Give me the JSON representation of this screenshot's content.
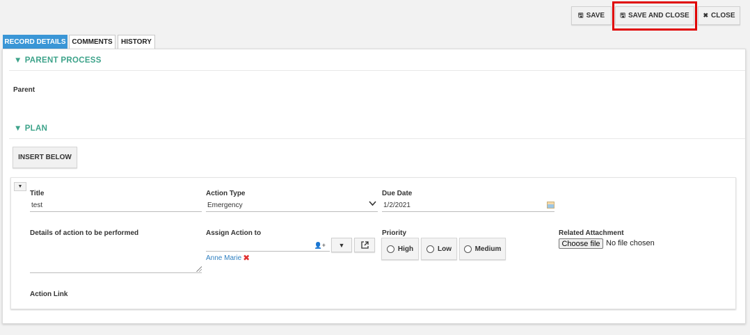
{
  "toolbar": {
    "save_label": "SAVE",
    "save_close_label": "SAVE AND CLOSE",
    "close_label": "CLOSE",
    "save_icon": "save-icon",
    "close_icon": "x-icon"
  },
  "tabs": [
    {
      "label": "RECORD DETAILS",
      "active": true
    },
    {
      "label": "COMMENTS",
      "active": false
    },
    {
      "label": "HISTORY",
      "active": false
    }
  ],
  "sections": {
    "parent_process": {
      "title": "PARENT PROCESS",
      "parent_label": "Parent"
    },
    "plan": {
      "title": "PLAN",
      "insert_below_label": "INSERT BELOW"
    }
  },
  "plan_item": {
    "title": {
      "label": "Title",
      "value": "test"
    },
    "action_type": {
      "label": "Action Type",
      "value": "Emergency"
    },
    "due_date": {
      "label": "Due Date",
      "value": "1/2/2021"
    },
    "details": {
      "label": "Details of action to be performed",
      "value": ""
    },
    "assign": {
      "label": "Assign Action to",
      "value": "",
      "assignee": "Anne Marie"
    },
    "priority": {
      "label": "Priority",
      "options": [
        "High",
        "Low",
        "Medium"
      ]
    },
    "attachment": {
      "label": "Related Attachment",
      "button": "Choose file",
      "status": "No file chosen"
    },
    "action_link": {
      "label": "Action Link"
    }
  },
  "colors": {
    "accent_tab": "#3a96d6",
    "section_heading": "#3da38a",
    "highlight": "#e00000",
    "link": "#2f7fc0",
    "remove": "#e03131"
  }
}
